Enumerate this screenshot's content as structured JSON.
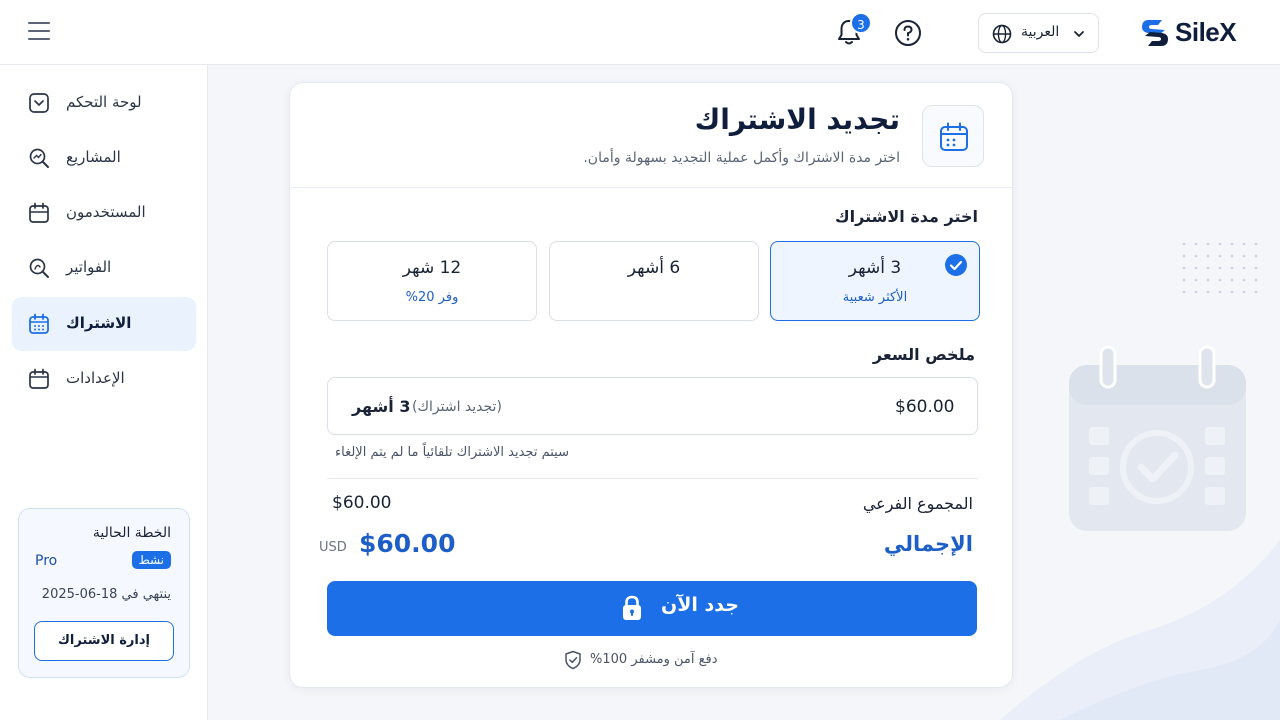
{
  "header": {
    "brand": "SileX",
    "language": "العربية",
    "notification_count": "3"
  },
  "sidebar": {
    "items": [
      {
        "label": "لوحة التحكم",
        "icon": "dashboard-icon"
      },
      {
        "label": "المشاريع",
        "icon": "projects-icon"
      },
      {
        "label": "المستخدمون",
        "icon": "users-icon"
      },
      {
        "label": "الفواتير",
        "icon": "invoices-icon"
      },
      {
        "label": "الاشتراك",
        "icon": "calendar-icon",
        "active": true
      },
      {
        "label": "الإعدادات",
        "icon": "settings-icon"
      }
    ],
    "plan": {
      "title": "الخطة الحالية",
      "name": "Pro",
      "status": "نشط",
      "expires": "ينتهي في 18-06-2025",
      "manage_label": "إدارة الاشتراك"
    }
  },
  "main": {
    "title": "تجديد الاشتراك",
    "subtitle": "اختر مدة الاشتراك وأكمل عملية التجديد بسهولة وأمان.",
    "duration_label": "اختر مدة الاشتراك",
    "options": [
      {
        "title": "3 أشهر",
        "subtitle": "الأكثر شعبية",
        "selected": true
      },
      {
        "title": "6 أشهر",
        "subtitle": "",
        "selected": false
      },
      {
        "title": "12 شهر",
        "subtitle": "وفر 20%",
        "selected": false
      }
    ],
    "summary_label": "ملخص السعر",
    "summary": {
      "duration": "3 أشهر",
      "tag": "(تجديد اشتراك)",
      "price": "$60.00"
    },
    "note": "سيتم تجديد الاشتراك تلقائياً ما لم يتم الإلغاء",
    "subtotal_label": "المجموع الفرعي",
    "subtotal": "$60.00",
    "total_label": "الإجمالي",
    "total": "$60.00",
    "currency": "USD",
    "cta_label": "جدد الآن",
    "secure_note": "دفع آمن ومشفر 100%"
  },
  "colors": {
    "accent": "#1d6fe8",
    "brand_dark": "#0f1e3d"
  }
}
